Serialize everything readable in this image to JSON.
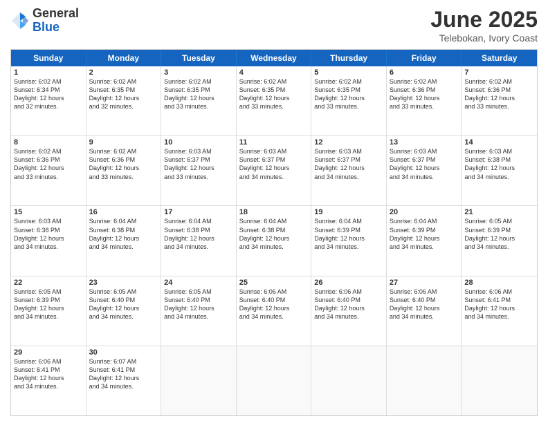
{
  "logo": {
    "general": "General",
    "blue": "Blue"
  },
  "title": "June 2025",
  "subtitle": "Telebokan, Ivory Coast",
  "header_days": [
    "Sunday",
    "Monday",
    "Tuesday",
    "Wednesday",
    "Thursday",
    "Friday",
    "Saturday"
  ],
  "weeks": [
    [
      {
        "day": "1",
        "sunrise": "6:02 AM",
        "sunset": "6:34 PM",
        "daylight": "12 hours and 32 minutes."
      },
      {
        "day": "2",
        "sunrise": "6:02 AM",
        "sunset": "6:35 PM",
        "daylight": "12 hours and 32 minutes."
      },
      {
        "day": "3",
        "sunrise": "6:02 AM",
        "sunset": "6:35 PM",
        "daylight": "12 hours and 33 minutes."
      },
      {
        "day": "4",
        "sunrise": "6:02 AM",
        "sunset": "6:35 PM",
        "daylight": "12 hours and 33 minutes."
      },
      {
        "day": "5",
        "sunrise": "6:02 AM",
        "sunset": "6:35 PM",
        "daylight": "12 hours and 33 minutes."
      },
      {
        "day": "6",
        "sunrise": "6:02 AM",
        "sunset": "6:36 PM",
        "daylight": "12 hours and 33 minutes."
      },
      {
        "day": "7",
        "sunrise": "6:02 AM",
        "sunset": "6:36 PM",
        "daylight": "12 hours and 33 minutes."
      }
    ],
    [
      {
        "day": "8",
        "sunrise": "6:02 AM",
        "sunset": "6:36 PM",
        "daylight": "12 hours and 33 minutes."
      },
      {
        "day": "9",
        "sunrise": "6:02 AM",
        "sunset": "6:36 PM",
        "daylight": "12 hours and 33 minutes."
      },
      {
        "day": "10",
        "sunrise": "6:03 AM",
        "sunset": "6:37 PM",
        "daylight": "12 hours and 33 minutes."
      },
      {
        "day": "11",
        "sunrise": "6:03 AM",
        "sunset": "6:37 PM",
        "daylight": "12 hours and 34 minutes."
      },
      {
        "day": "12",
        "sunrise": "6:03 AM",
        "sunset": "6:37 PM",
        "daylight": "12 hours and 34 minutes."
      },
      {
        "day": "13",
        "sunrise": "6:03 AM",
        "sunset": "6:37 PM",
        "daylight": "12 hours and 34 minutes."
      },
      {
        "day": "14",
        "sunrise": "6:03 AM",
        "sunset": "6:38 PM",
        "daylight": "12 hours and 34 minutes."
      }
    ],
    [
      {
        "day": "15",
        "sunrise": "6:03 AM",
        "sunset": "6:38 PM",
        "daylight": "12 hours and 34 minutes."
      },
      {
        "day": "16",
        "sunrise": "6:04 AM",
        "sunset": "6:38 PM",
        "daylight": "12 hours and 34 minutes."
      },
      {
        "day": "17",
        "sunrise": "6:04 AM",
        "sunset": "6:38 PM",
        "daylight": "12 hours and 34 minutes."
      },
      {
        "day": "18",
        "sunrise": "6:04 AM",
        "sunset": "6:38 PM",
        "daylight": "12 hours and 34 minutes."
      },
      {
        "day": "19",
        "sunrise": "6:04 AM",
        "sunset": "6:39 PM",
        "daylight": "12 hours and 34 minutes."
      },
      {
        "day": "20",
        "sunrise": "6:04 AM",
        "sunset": "6:39 PM",
        "daylight": "12 hours and 34 minutes."
      },
      {
        "day": "21",
        "sunrise": "6:05 AM",
        "sunset": "6:39 PM",
        "daylight": "12 hours and 34 minutes."
      }
    ],
    [
      {
        "day": "22",
        "sunrise": "6:05 AM",
        "sunset": "6:39 PM",
        "daylight": "12 hours and 34 minutes."
      },
      {
        "day": "23",
        "sunrise": "6:05 AM",
        "sunset": "6:40 PM",
        "daylight": "12 hours and 34 minutes."
      },
      {
        "day": "24",
        "sunrise": "6:05 AM",
        "sunset": "6:40 PM",
        "daylight": "12 hours and 34 minutes."
      },
      {
        "day": "25",
        "sunrise": "6:06 AM",
        "sunset": "6:40 PM",
        "daylight": "12 hours and 34 minutes."
      },
      {
        "day": "26",
        "sunrise": "6:06 AM",
        "sunset": "6:40 PM",
        "daylight": "12 hours and 34 minutes."
      },
      {
        "day": "27",
        "sunrise": "6:06 AM",
        "sunset": "6:40 PM",
        "daylight": "12 hours and 34 minutes."
      },
      {
        "day": "28",
        "sunrise": "6:06 AM",
        "sunset": "6:41 PM",
        "daylight": "12 hours and 34 minutes."
      }
    ],
    [
      {
        "day": "29",
        "sunrise": "6:06 AM",
        "sunset": "6:41 PM",
        "daylight": "12 hours and 34 minutes."
      },
      {
        "day": "30",
        "sunrise": "6:07 AM",
        "sunset": "6:41 PM",
        "daylight": "12 hours and 34 minutes."
      },
      null,
      null,
      null,
      null,
      null
    ]
  ]
}
